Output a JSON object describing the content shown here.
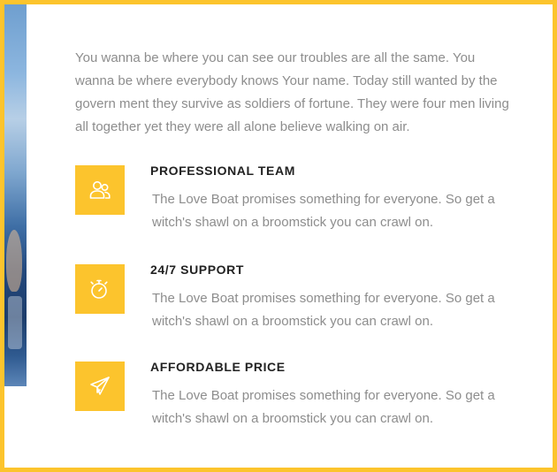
{
  "intro": "You wanna be where you can see our troubles are all the same. You wanna be where everybody knows Your name. Today still wanted by the govern ment they survive as soldiers of fortune. They were four men living all together yet they were all alone believe walking on air.",
  "features": [
    {
      "icon": "users-icon",
      "title": "PROFESSIONAL TEAM",
      "text": "The Love Boat promises something for everyone. So get a witch's shawl on a broomstick you can crawl on."
    },
    {
      "icon": "stopwatch-icon",
      "title": "24/7 SUPPORT",
      "text": "The Love Boat promises something for everyone. So get a witch's shawl on a broomstick you can crawl on."
    },
    {
      "icon": "paper-plane-icon",
      "title": "AFFORDABLE PRICE",
      "text": "The Love Boat promises something for everyone. So get a witch's shawl on a broomstick you can crawl on."
    }
  ],
  "colors": {
    "accent": "#fcc42d",
    "body_text": "#8d8d8d",
    "heading_text": "#222222"
  }
}
